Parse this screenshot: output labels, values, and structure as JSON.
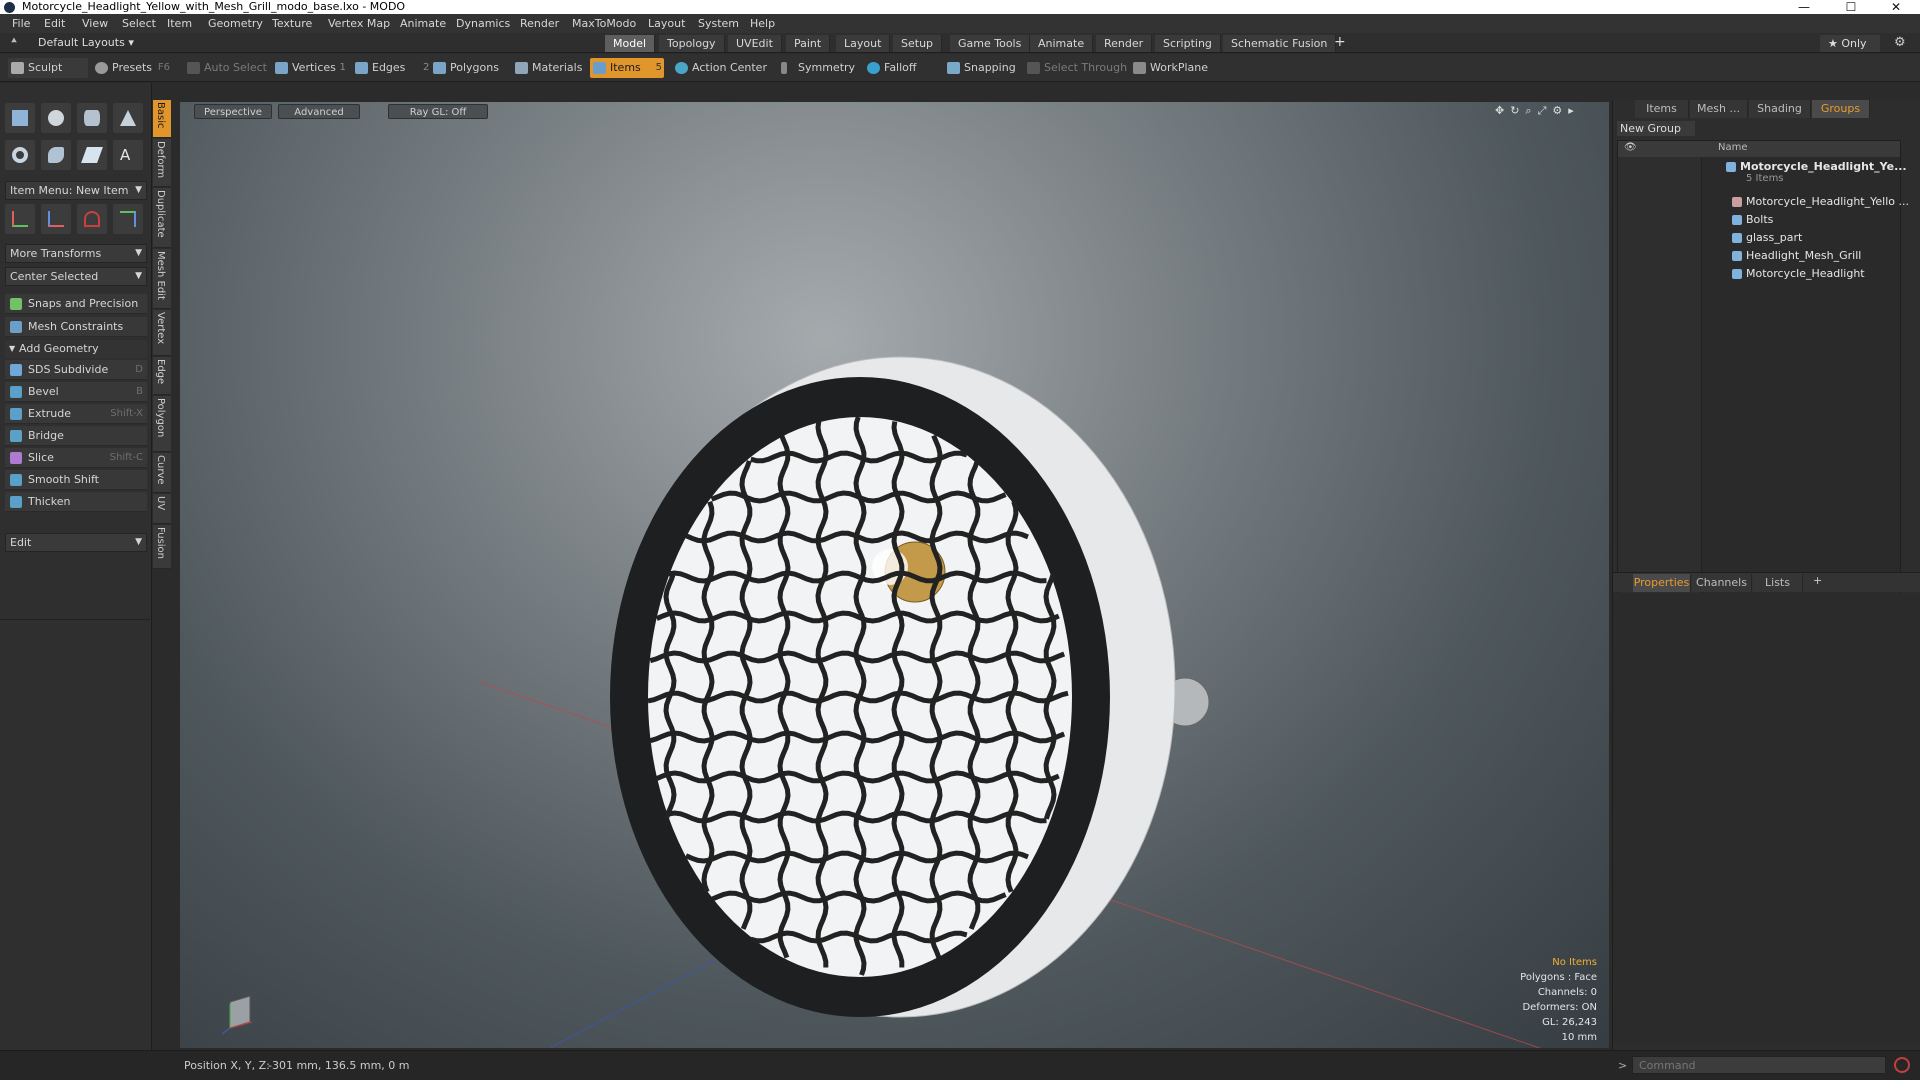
{
  "window": {
    "title": "Motorcycle_Headlight_Yellow_with_Mesh_Grill_modo_base.lxo - MODO",
    "minimize": "—",
    "maximize": "☐",
    "close": "✕"
  },
  "menu": [
    "File",
    "Edit",
    "View",
    "Select",
    "Item",
    "Geometry",
    "Texture",
    "Vertex Map",
    "Animate",
    "Dynamics",
    "Render",
    "MaxToModo",
    "Layout",
    "System",
    "Help"
  ],
  "layoutbar": {
    "default_layouts": "Default Layouts",
    "tabs": [
      "Model",
      "Topology",
      "UVEdit",
      "Paint",
      "Layout",
      "Setup",
      "Game Tools",
      "Animate",
      "Render",
      "Scripting",
      "Schematic Fusion"
    ],
    "active_tab": "Model",
    "add": "+",
    "only": "★ Only",
    "gear": "⚙"
  },
  "toolbar": {
    "sculpt": "Sculpt",
    "presets": "Presets",
    "presets_key": "F6",
    "auto_select": "Auto Select",
    "vertices": "Vertices",
    "vertices_num": "1",
    "edges": "Edges",
    "edges_num": "2",
    "polygons": "Polygons",
    "materials": "Materials",
    "items": "Items",
    "items_num": "5",
    "action_center": "Action Center",
    "symmetry": "Symmetry",
    "falloff": "Falloff",
    "snapping": "Snapping",
    "select_through": "Select Through",
    "workplane": "WorkPlane"
  },
  "leftpanel": {
    "item_menu": "Item Menu: New Item",
    "more_transforms": "More Transforms",
    "center_selected": "Center Selected",
    "snaps": "Snaps and Precision",
    "mesh_constraints": "Mesh Constraints",
    "add_geometry": "Add Geometry",
    "tools": [
      {
        "label": "SDS Subdivide",
        "key": "D",
        "color": "#6fa8d8"
      },
      {
        "label": "Bevel",
        "key": "B",
        "color": "#5aa0c8"
      },
      {
        "label": "Extrude",
        "key": "Shift-X",
        "color": "#5aa0c8"
      },
      {
        "label": "Bridge",
        "key": "",
        "color": "#5aa0c8"
      },
      {
        "label": "Slice",
        "key": "Shift-C",
        "color": "#b07ad0"
      },
      {
        "label": "Smooth Shift",
        "key": "",
        "color": "#5aa0c8"
      },
      {
        "label": "Thicken",
        "key": "",
        "color": "#5aa0c8"
      }
    ],
    "edit": "Edit"
  },
  "sidetabs": [
    "Basic",
    "Deform",
    "Duplicate",
    "Mesh Edit",
    "Vertex",
    "Edge",
    "Polygon",
    "Curve",
    "UV",
    "Fusion"
  ],
  "viewport": {
    "perspective": "Perspective",
    "advanced": "Advanced",
    "raygl": "Ray GL: Off",
    "info": {
      "no_items": "No Items",
      "polygons": "Polygons : Face",
      "channels": "Channels: 0",
      "deformers": "Deformers: ON",
      "gl": "GL: 26,243",
      "scale": "10 mm"
    }
  },
  "rightpanel": {
    "tabs": [
      "Items",
      "Mesh ...",
      "Shading",
      "Groups"
    ],
    "active_tab": "Groups",
    "new_group": "New Group",
    "name_col": "Name",
    "group_name": "Motorcycle_Headlight_Ye...",
    "group_count": "5 Items",
    "items": [
      "Motorcycle_Headlight_Yello ...",
      "Bolts",
      "glass_part",
      "Headlight_Mesh_Grill",
      "Motorcycle_Headlight"
    ],
    "bottom_tabs": [
      "Properties",
      "Channels",
      "Lists"
    ],
    "bottom_active": "Properties",
    "add": "+"
  },
  "statusbar": {
    "position_label": "Position X, Y, Z:",
    "position_value": "-301 mm, 136.5 mm, 0 m",
    "command_placeholder": "Command",
    "prompt": ">"
  },
  "colors": {
    "accent": "#e0962a",
    "panel": "#2f2f2f",
    "selection": "#e89b30"
  }
}
